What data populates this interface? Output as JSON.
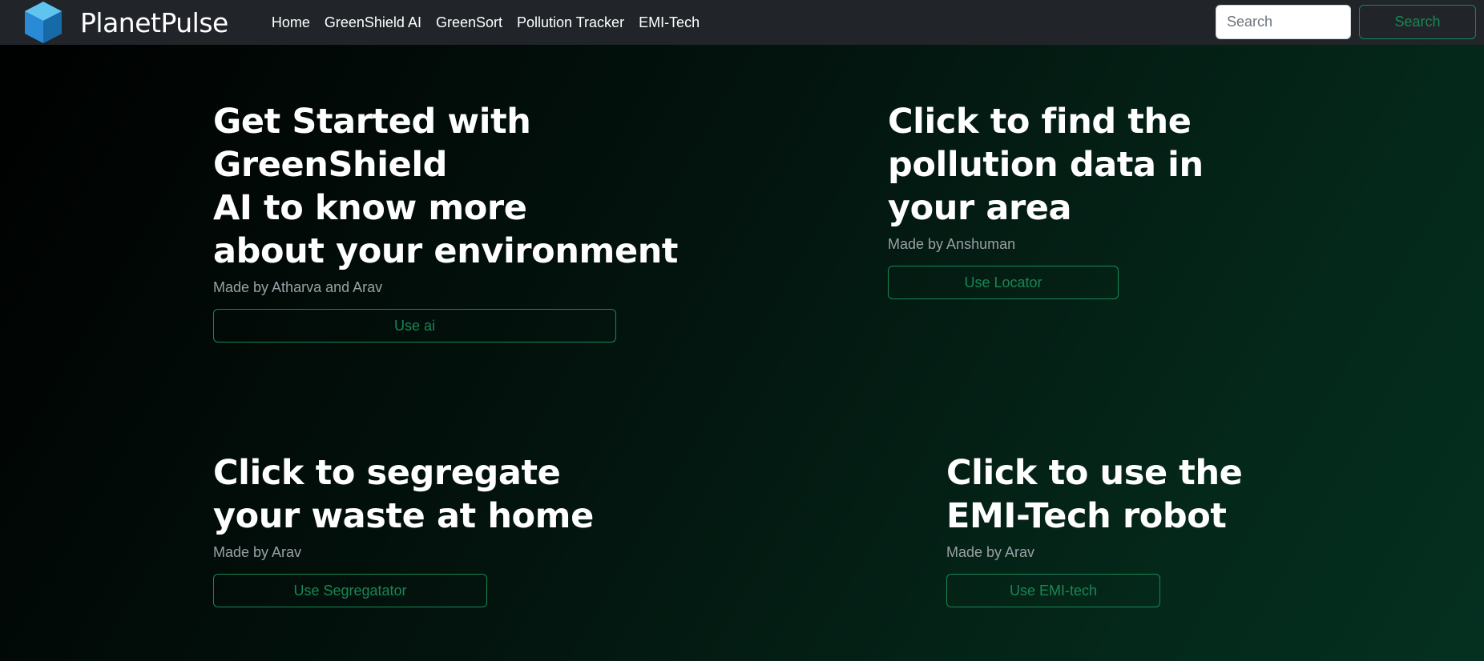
{
  "brand": {
    "name": "PlanetPulse",
    "logo_icon": "hexagon-cube-logo-icon"
  },
  "nav": {
    "links": [
      "Home",
      "GreenShield AI",
      "GreenSort",
      "Pollution Tracker",
      "EMI-Tech"
    ]
  },
  "search": {
    "placeholder": "Search",
    "button_label": "Search"
  },
  "cards": [
    {
      "title_lines": [
        "Get Started with GreenShield",
        "AI to know more",
        "about your environment"
      ],
      "author": "Made by Atharva and Arav",
      "button": "Use ai"
    },
    {
      "title_lines": [
        "Click to find the",
        "pollution data in",
        "your area"
      ],
      "author": "Made by Anshuman",
      "button": "Use Locator"
    },
    {
      "title_lines": [
        "Click to segregate",
        "your waste at home"
      ],
      "author": "Made by Arav",
      "button": "Use Segregatator"
    },
    {
      "title_lines": [
        "Click to use the",
        "EMI-Tech robot"
      ],
      "author": "Made by Arav",
      "button": "Use EMI-tech"
    }
  ],
  "colors": {
    "navbar_bg": "#212529",
    "accent_green": "#198754",
    "muted_text": "#9aa0a6"
  }
}
